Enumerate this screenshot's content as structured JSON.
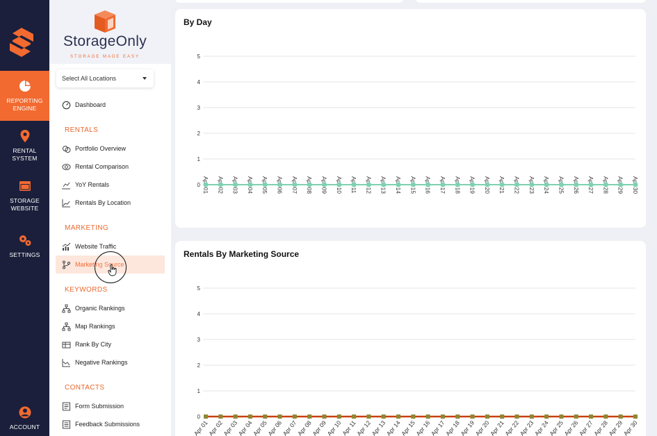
{
  "rail": {
    "items": [
      {
        "label": "REPORTING\nENGINE",
        "icon": "pie-chart-icon",
        "active": true
      },
      {
        "label": "RENTAL\nSYSTEM",
        "icon": "location-pin-icon",
        "active": false
      },
      {
        "label": "STORAGE\nWEBSITE",
        "icon": "browser-window-icon",
        "active": false
      },
      {
        "label": "SETTINGS",
        "icon": "gears-icon",
        "active": false
      },
      {
        "label": "ACCOUNT",
        "icon": "user-circle-icon",
        "active": false
      }
    ]
  },
  "brand": {
    "name": "StorageOnly",
    "tagline": "STORAGE MADE EASY"
  },
  "location_select": {
    "value": "Select All Locations"
  },
  "menu": {
    "dashboard": "Dashboard",
    "sections": {
      "rentals": "RENTALS",
      "marketing": "MARKETING",
      "keywords": "KEYWORDS",
      "contacts": "CONTACTS"
    },
    "rentals": [
      "Portfolio Overview",
      "Rental Comparison",
      "YoY Rentals",
      "Rentals By Location"
    ],
    "marketing": [
      "Website Traffic",
      "Marketing Source"
    ],
    "keywords": [
      "Organic Rankings",
      "Map Rankings",
      "Rank By City",
      "Negative Rankings"
    ],
    "contacts": [
      "Form Submission",
      "Feedback Submissions"
    ]
  },
  "colors": {
    "accent": "#f26a30",
    "rail_bg": "#1b1f3b",
    "series_day": "#7fd1b0",
    "series_source_line": "#c8400f",
    "series_source_marker": "#8c8a35"
  },
  "cards": {
    "by_day_title": "By Day",
    "marketing_title": "Rentals By Marketing Source"
  },
  "chart_data": [
    {
      "type": "line",
      "title": "By Day",
      "x": [
        "Apr 01",
        "Apr 02",
        "Apr 03",
        "Apr 04",
        "Apr 05",
        "Apr 06",
        "Apr 07",
        "Apr 08",
        "Apr 09",
        "Apr 10",
        "Apr 11",
        "Apr 12",
        "Apr 13",
        "Apr 14",
        "Apr 15",
        "Apr 16",
        "Apr 17",
        "Apr 18",
        "Apr 19",
        "Apr 20",
        "Apr 21",
        "Apr 22",
        "Apr 23",
        "Apr 24",
        "Apr 25",
        "Apr 26",
        "Apr 27",
        "Apr 28",
        "Apr 29",
        "Apr 30"
      ],
      "yticks": [
        "0",
        "1",
        "2",
        "3",
        "4",
        "5"
      ],
      "ylim": [
        0,
        5
      ],
      "series": [
        {
          "values": [
            0,
            0,
            0,
            0,
            0,
            0,
            0,
            0,
            0,
            0,
            0,
            0,
            0,
            0,
            0,
            0,
            0,
            0,
            0,
            0,
            0,
            0,
            0,
            0,
            0,
            0,
            0,
            0,
            0,
            0
          ]
        }
      ],
      "grid": true
    },
    {
      "type": "line",
      "title": "Rentals By Marketing Source",
      "x": [
        "Apr 01",
        "Apr 02",
        "Apr 03",
        "Apr 04",
        "Apr 05",
        "Apr 06",
        "Apr 07",
        "Apr 08",
        "Apr 09",
        "Apr 10",
        "Apr 11",
        "Apr 12",
        "Apr 13",
        "Apr 14",
        "Apr 15",
        "Apr 16",
        "Apr 17",
        "Apr 18",
        "Apr 19",
        "Apr 20",
        "Apr 21",
        "Apr 22",
        "Apr 23",
        "Apr 24",
        "Apr 25",
        "Apr 26",
        "Apr 27",
        "Apr 28",
        "Apr 29",
        "Apr 30"
      ],
      "yticks": [
        "0",
        "1",
        "2",
        "3",
        "4",
        "5"
      ],
      "ylim": [
        0,
        5
      ],
      "series": [
        {
          "values": [
            0,
            0,
            0,
            0,
            0,
            0,
            0,
            0,
            0,
            0,
            0,
            0,
            0,
            0,
            0,
            0,
            0,
            0,
            0,
            0,
            0,
            0,
            0,
            0,
            0,
            0,
            0,
            0,
            0,
            0
          ]
        }
      ],
      "grid": true
    }
  ]
}
